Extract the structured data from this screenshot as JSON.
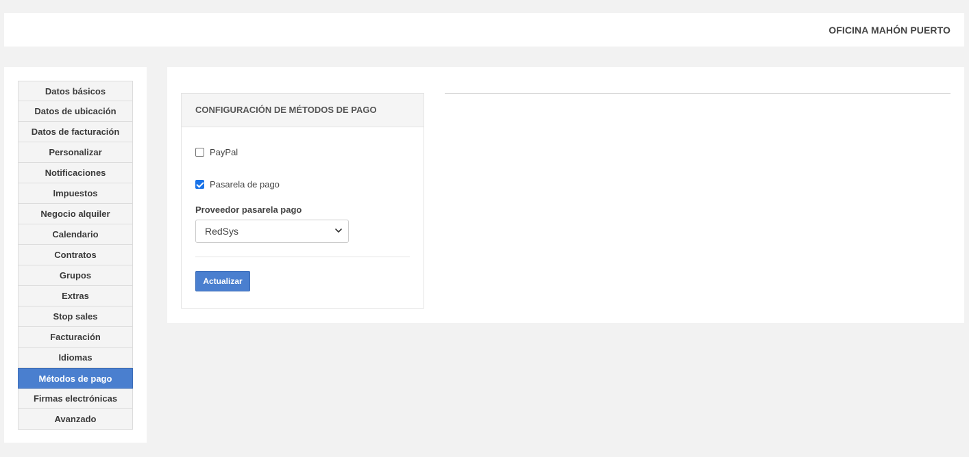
{
  "header": {
    "office": "OFICINA MAHÓN PUERTO"
  },
  "sidebar": {
    "items": [
      {
        "label": "Datos básicos"
      },
      {
        "label": "Datos de ubicación"
      },
      {
        "label": "Datos de facturación"
      },
      {
        "label": "Personalizar"
      },
      {
        "label": "Notificaciones"
      },
      {
        "label": "Impuestos"
      },
      {
        "label": "Negocio alquiler"
      },
      {
        "label": "Calendario"
      },
      {
        "label": "Contratos"
      },
      {
        "label": "Grupos"
      },
      {
        "label": "Extras"
      },
      {
        "label": "Stop sales"
      },
      {
        "label": "Facturación"
      },
      {
        "label": "Idiomas"
      },
      {
        "label": "Métodos de pago",
        "active": true
      },
      {
        "label": "Firmas electrónicas"
      },
      {
        "label": "Avanzado"
      }
    ]
  },
  "panel": {
    "title": "CONFIGURACIÓN DE MÉTODOS DE PAGO",
    "paypal": {
      "label": "PayPal",
      "checked": false
    },
    "pasarela": {
      "label": "Pasarela de pago",
      "checked": true
    },
    "provider": {
      "label": "Proveedor pasarela pago",
      "value": "RedSys"
    },
    "submit_label": "Actualizar"
  },
  "colors": {
    "accent": "#4a7fcf",
    "checkbox": "#1a73e8"
  }
}
